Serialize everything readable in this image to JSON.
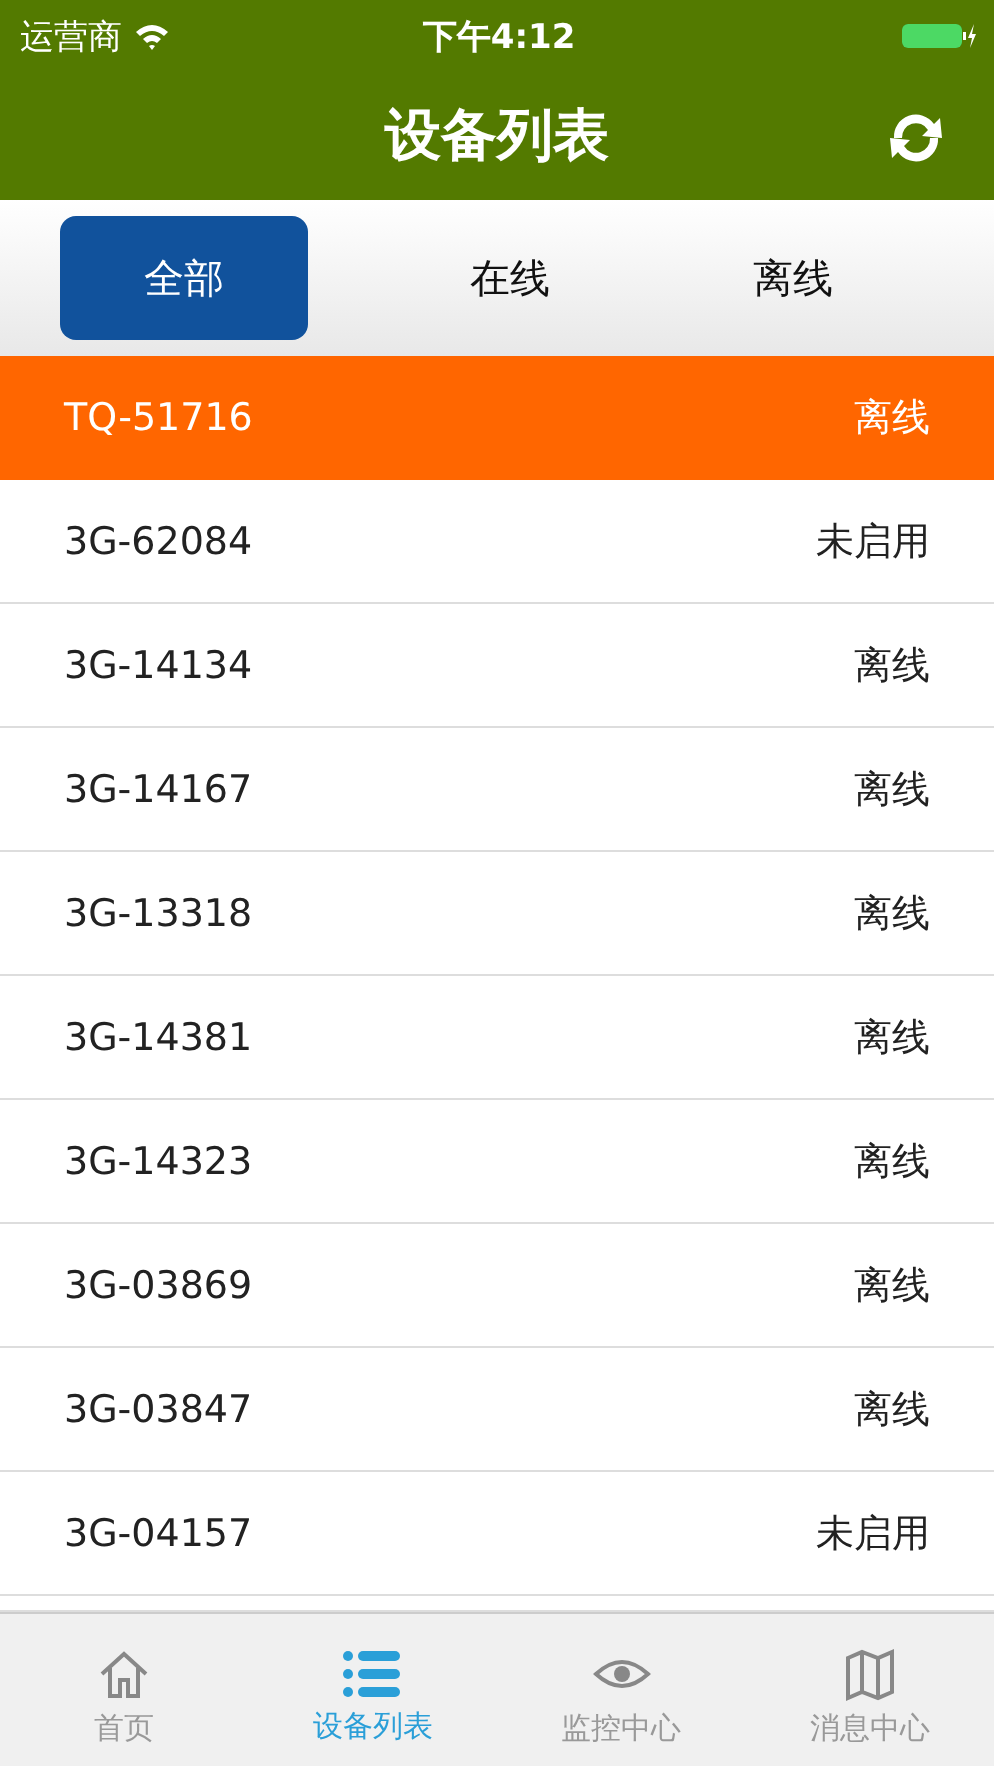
{
  "status_bar": {
    "carrier": "运营商",
    "time": "下午4:12"
  },
  "header": {
    "title": "设备列表"
  },
  "filter_tabs": [
    {
      "label": "全部",
      "selected": true
    },
    {
      "label": "在线",
      "selected": false
    },
    {
      "label": "离线",
      "selected": false
    }
  ],
  "devices": [
    {
      "name": "TQ-51716",
      "status": "离线",
      "selected": true
    },
    {
      "name": "3G-62084",
      "status": "未启用",
      "selected": false
    },
    {
      "name": "3G-14134",
      "status": "离线",
      "selected": false
    },
    {
      "name": "3G-14167",
      "status": "离线",
      "selected": false
    },
    {
      "name": "3G-13318",
      "status": "离线",
      "selected": false
    },
    {
      "name": "3G-14381",
      "status": "离线",
      "selected": false
    },
    {
      "name": "3G-14323",
      "status": "离线",
      "selected": false
    },
    {
      "name": "3G-03869",
      "status": "离线",
      "selected": false
    },
    {
      "name": "3G-03847",
      "status": "离线",
      "selected": false
    },
    {
      "name": "3G-04157",
      "status": "未启用",
      "selected": false
    }
  ],
  "tab_bar": [
    {
      "label": "首页",
      "kind": "home",
      "selected": false
    },
    {
      "label": "设备列表",
      "kind": "list",
      "selected": true
    },
    {
      "label": "监控中心",
      "kind": "eye",
      "selected": false
    },
    {
      "label": "消息中心",
      "kind": "map",
      "selected": false
    }
  ]
}
